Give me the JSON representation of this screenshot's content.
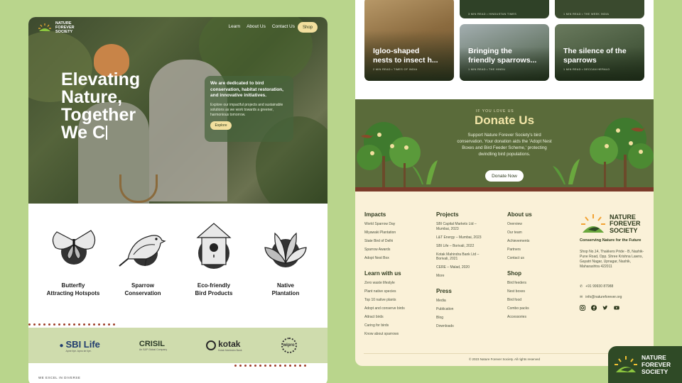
{
  "brand": {
    "name_lines": [
      "NATURE",
      "FOREVER",
      "SOCIETY"
    ],
    "tagline": "Conserving Nature for the Future",
    "colors": {
      "background": "#b9d58c",
      "dark_green": "#2f4a26",
      "cream": "#faf1d8",
      "accent_yellow": "#f2df9e"
    }
  },
  "nav": {
    "links": [
      "Learn",
      "About Us",
      "Contact Us"
    ],
    "shop_label": "Shop"
  },
  "hero": {
    "title_lines": [
      "Elevating",
      "Nature,",
      "Together",
      "We C"
    ],
    "box_title": "We are dedicated to bird conservation, habitat restoration, and innovative initiatives.",
    "box_text": "Explore our impactful projects and sustainable solutions as we work towards a greener, harmonious tomorrow.",
    "explore_label": "Explore"
  },
  "features": [
    {
      "label_lines": [
        "Butterfly",
        "Attracting Hotspots"
      ],
      "icon": "butterfly-icon"
    },
    {
      "label_lines": [
        "Sparrow",
        "Conservation"
      ],
      "icon": "sparrow-icon"
    },
    {
      "label_lines": [
        "Eco-friendly",
        "Bird Products"
      ],
      "icon": "birdhouse-icon"
    },
    {
      "label_lines": [
        "Native",
        "Plantation"
      ],
      "icon": "plant-icon"
    }
  ],
  "partners": [
    {
      "name": "SBI Life",
      "sub": "Apne liye. Apno ke liye."
    },
    {
      "name": "CRISIL",
      "sub": "An S&P Global Company"
    },
    {
      "name": "kotak",
      "sub": "Kotak Mahindra Bank"
    },
    {
      "name": "wipro",
      "sub": ""
    }
  ],
  "excel_text": "WE EXCEL IN DIVERSE",
  "blog": [
    {
      "title_lines": [
        "Igloo-shaped",
        "nests to insect h..."
      ],
      "meta": "2 MIN READ • TIMES OF INDIA"
    },
    {
      "title_lines": [
        "Bringing the",
        "friendly sparrows..."
      ],
      "meta": "1 MIN READ • THE HINDU"
    },
    {
      "title_lines": [
        "The silence of the",
        "sparrows"
      ],
      "meta": "1 MIN READ • DECCAN HERALD"
    }
  ],
  "blog_top_meta": [
    "3 MIN READ • HINDUSTAN TIMES",
    "1 MIN READ • THE WEEK INDIA"
  ],
  "donate": {
    "kicker": "IF YOU LOVE US",
    "title": "Donate Us",
    "text": "Support Nature Forever Society's bird conservation. Your donation aids the 'Adopt Nest Boxes and Bird Feeder Scheme,' protecting dwindling bird populations.",
    "button_label": "Donate Now"
  },
  "footer": {
    "impacts": {
      "heading": "Impacts",
      "items": [
        "World Sparrow Day",
        "Miyawaki Plantation",
        "State Bird of Delhi",
        "Sparrow Awards",
        "Adopt Nest Box"
      ]
    },
    "learn": {
      "heading": "Learn with us",
      "items": [
        "Zero waste lifestyle",
        "Plant native species",
        "Top 10 native plants",
        "Adopt and conserve birds",
        "Attract birds",
        "Caring for birds",
        "Know about sparrows"
      ]
    },
    "projects": {
      "heading": "Projects",
      "items": [
        "SBI Capital Markets Ltd – Mumbai, 2023",
        "L&T Energy – Mumbai, 2023",
        "SBI Life – Borivali, 2022",
        "Kotak Mahindra Bank Ltd – Borivali, 2021",
        "CERE – Malad, 2020",
        "More"
      ]
    },
    "press": {
      "heading": "Press",
      "items": [
        "Media",
        "Publication",
        "Blog",
        "Downloads"
      ]
    },
    "about": {
      "heading": "About us",
      "items": [
        "Overview",
        "Our team",
        "Achievements",
        "Partners",
        "Contact us"
      ]
    },
    "shop": {
      "heading": "Shop",
      "items": [
        "Bird feeders",
        "Nest boxes",
        "Bird food",
        "Combo packs",
        "Accessories"
      ]
    },
    "address": "Shop No.14, Thakkers Pride - B, Nashik- Pune Road, Opp. Shree Krishna Lawns, Gayatri Nagar, Upnagar, Nashik, Maharashtra 422011",
    "phone": "+91 99930 87988",
    "email": "info@natureforever.org",
    "copyright": "© 2023 Nature Forever Society. All rights reserved"
  }
}
